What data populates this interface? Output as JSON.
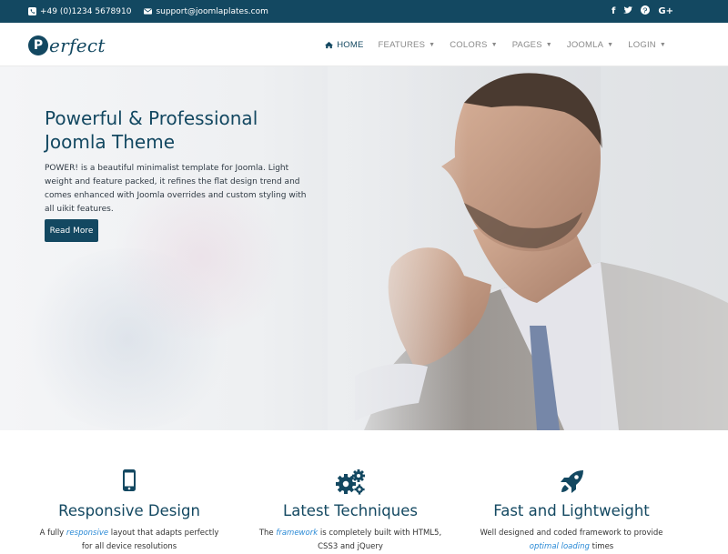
{
  "topbar": {
    "phone": "+49 (0)1234 5678910",
    "email": "support@joomlaplates.com",
    "social": [
      "f",
      "twitter",
      "pinterest",
      "G+"
    ]
  },
  "header": {
    "logo_letter": "P",
    "logo_word": "erfect",
    "nav": [
      {
        "label": "HOME",
        "active": true
      },
      {
        "label": "FEATURES"
      },
      {
        "label": "COLORS"
      },
      {
        "label": "PAGES"
      },
      {
        "label": "JOOMLA"
      },
      {
        "label": "LOGIN"
      }
    ]
  },
  "hero": {
    "title_line1": "Powerful & Professional",
    "title_line2": "Joomla Theme",
    "description": "POWER! is a beautiful minimalist template for Joomla. Light weight and feature packed, it refines the flat design trend and comes enhanced with Joomla overrides and custom styling with all uikit features.",
    "button": "Read More"
  },
  "features": [
    {
      "icon": "mobile-icon",
      "title": "Responsive Design",
      "text_before": "A fully ",
      "text_em": "responsive",
      "text_after": " layout that adapts perfectly for all device resolutions"
    },
    {
      "icon": "gears-icon",
      "title": "Latest Techniques",
      "text_before": "The ",
      "text_em": "framework",
      "text_after": " is completely built with HTML5, CSS3 and jQuery"
    },
    {
      "icon": "rocket-icon",
      "title": "Fast and Lightweight",
      "text_before": "Well designed and coded framework to provide ",
      "text_em": "optimal loading",
      "text_after": " times"
    }
  ],
  "colors": {
    "primary": "#134861",
    "link": "#2a8ad6"
  }
}
